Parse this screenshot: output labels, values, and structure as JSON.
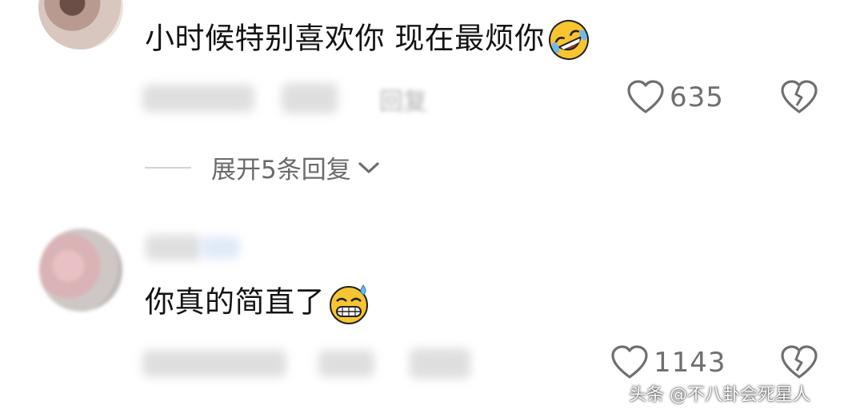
{
  "comments": [
    {
      "text": "小时候特别喜欢你 现在最烦你",
      "emoji": "rolling-on-floor-laughing-emoji",
      "reply_label": "回复",
      "likes": "635"
    },
    {
      "text": "你真的简直了",
      "emoji": "grinning-sweat-emoji",
      "likes": "1143"
    }
  ],
  "expand_replies": {
    "label": "展开5条回复"
  },
  "watermark": "头条 @不八卦会死星人",
  "colors": {
    "text": "#141414",
    "meta": "#6f6f6f",
    "divider": "#d4d4d4",
    "blur": "#d9d9d9",
    "emoji_yellow": "#f7c531"
  },
  "icons": [
    "heart-outline-icon",
    "broken-heart-icon",
    "chevron-down-icon"
  ]
}
